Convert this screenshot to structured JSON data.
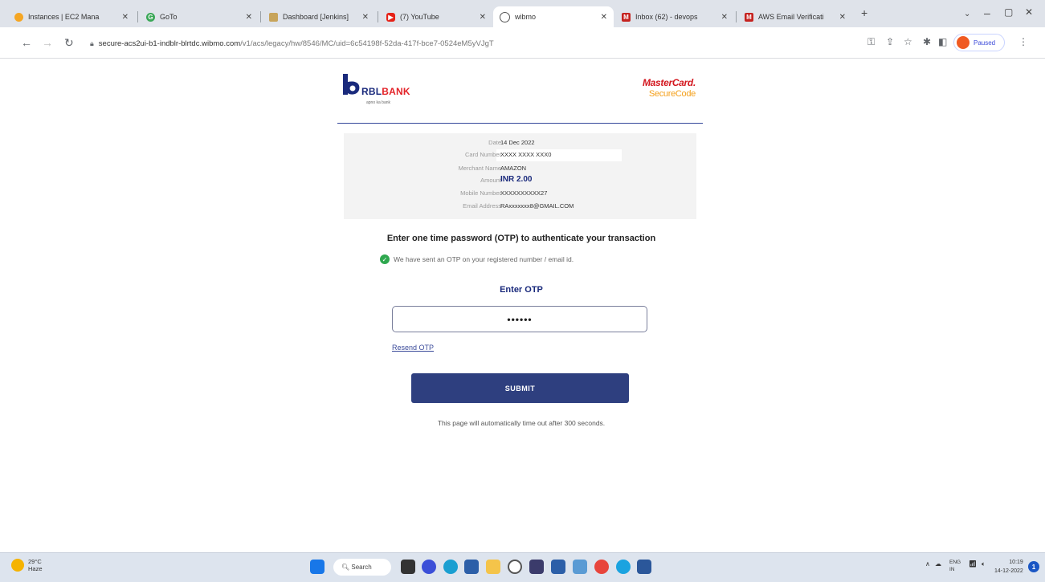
{
  "browser": {
    "tabs": [
      {
        "title": "Instances | EC2 Mana",
        "fav_color": "#f5a623",
        "icon": "aws-icon"
      },
      {
        "title": "GoTo",
        "fav_color": "#3aa757",
        "icon": "goto-icon"
      },
      {
        "title": "Dashboard [Jenkins]",
        "fav_color": "#c7a45b",
        "icon": "jenkins-icon"
      },
      {
        "title": "(7) YouTube",
        "fav_color": "#e62117",
        "icon": "youtube-icon"
      },
      {
        "title": "wibmo",
        "fav_color": "#555555",
        "icon": "globe-icon"
      },
      {
        "title": "Inbox (62) - devops",
        "fav_color": "#c5221f",
        "icon": "gmail-icon"
      },
      {
        "title": "AWS Email Verificati",
        "fav_color": "#c5221f",
        "icon": "gmail-icon"
      }
    ],
    "url_host": "secure-acs2ui-b1-indblr-blrtdc.wibmo.com",
    "url_path": "/v1/acs/legacy/hw/8546/MC/uid=6c54198f-52da-417f-bce7-0524eM5yVJgT",
    "profile_label": "Paused"
  },
  "bank": {
    "name_dark": "RBL",
    "name_red": "BANK",
    "tagline": "apno ka bank",
    "scheme_line1": "MasterCard.",
    "scheme_line2": "SecureCode"
  },
  "details": [
    {
      "label": "Date",
      "value": "14 Dec 2022"
    },
    {
      "label": "Card Number",
      "value": "XXXX XXXX XXX0"
    },
    {
      "label": "Merchant Name",
      "value": "AMAZON"
    },
    {
      "label": "Amount",
      "value": "INR 2.00"
    },
    {
      "label": "Mobile Number",
      "value": "XXXXXXXXXX27"
    },
    {
      "label": "Email Address",
      "value": "RAxxxxxxx8@GMAIL.COM"
    }
  ],
  "otp": {
    "heading": "Enter one time password (OTP) to authenticate your transaction",
    "sent_message": "We have sent an OTP on your registered number / email id.",
    "label": "Enter OTP",
    "value": "••••••",
    "resend": "Resend OTP",
    "submit": "SUBMIT",
    "timeout_message": "This page will automatically time out after 300 seconds."
  },
  "taskbar": {
    "temp": "29°C",
    "condition": "Haze",
    "search": "Search",
    "lang1": "ENG",
    "lang2": "IN",
    "time": "10:19",
    "date": "14-12-2022",
    "notifications": "1"
  }
}
